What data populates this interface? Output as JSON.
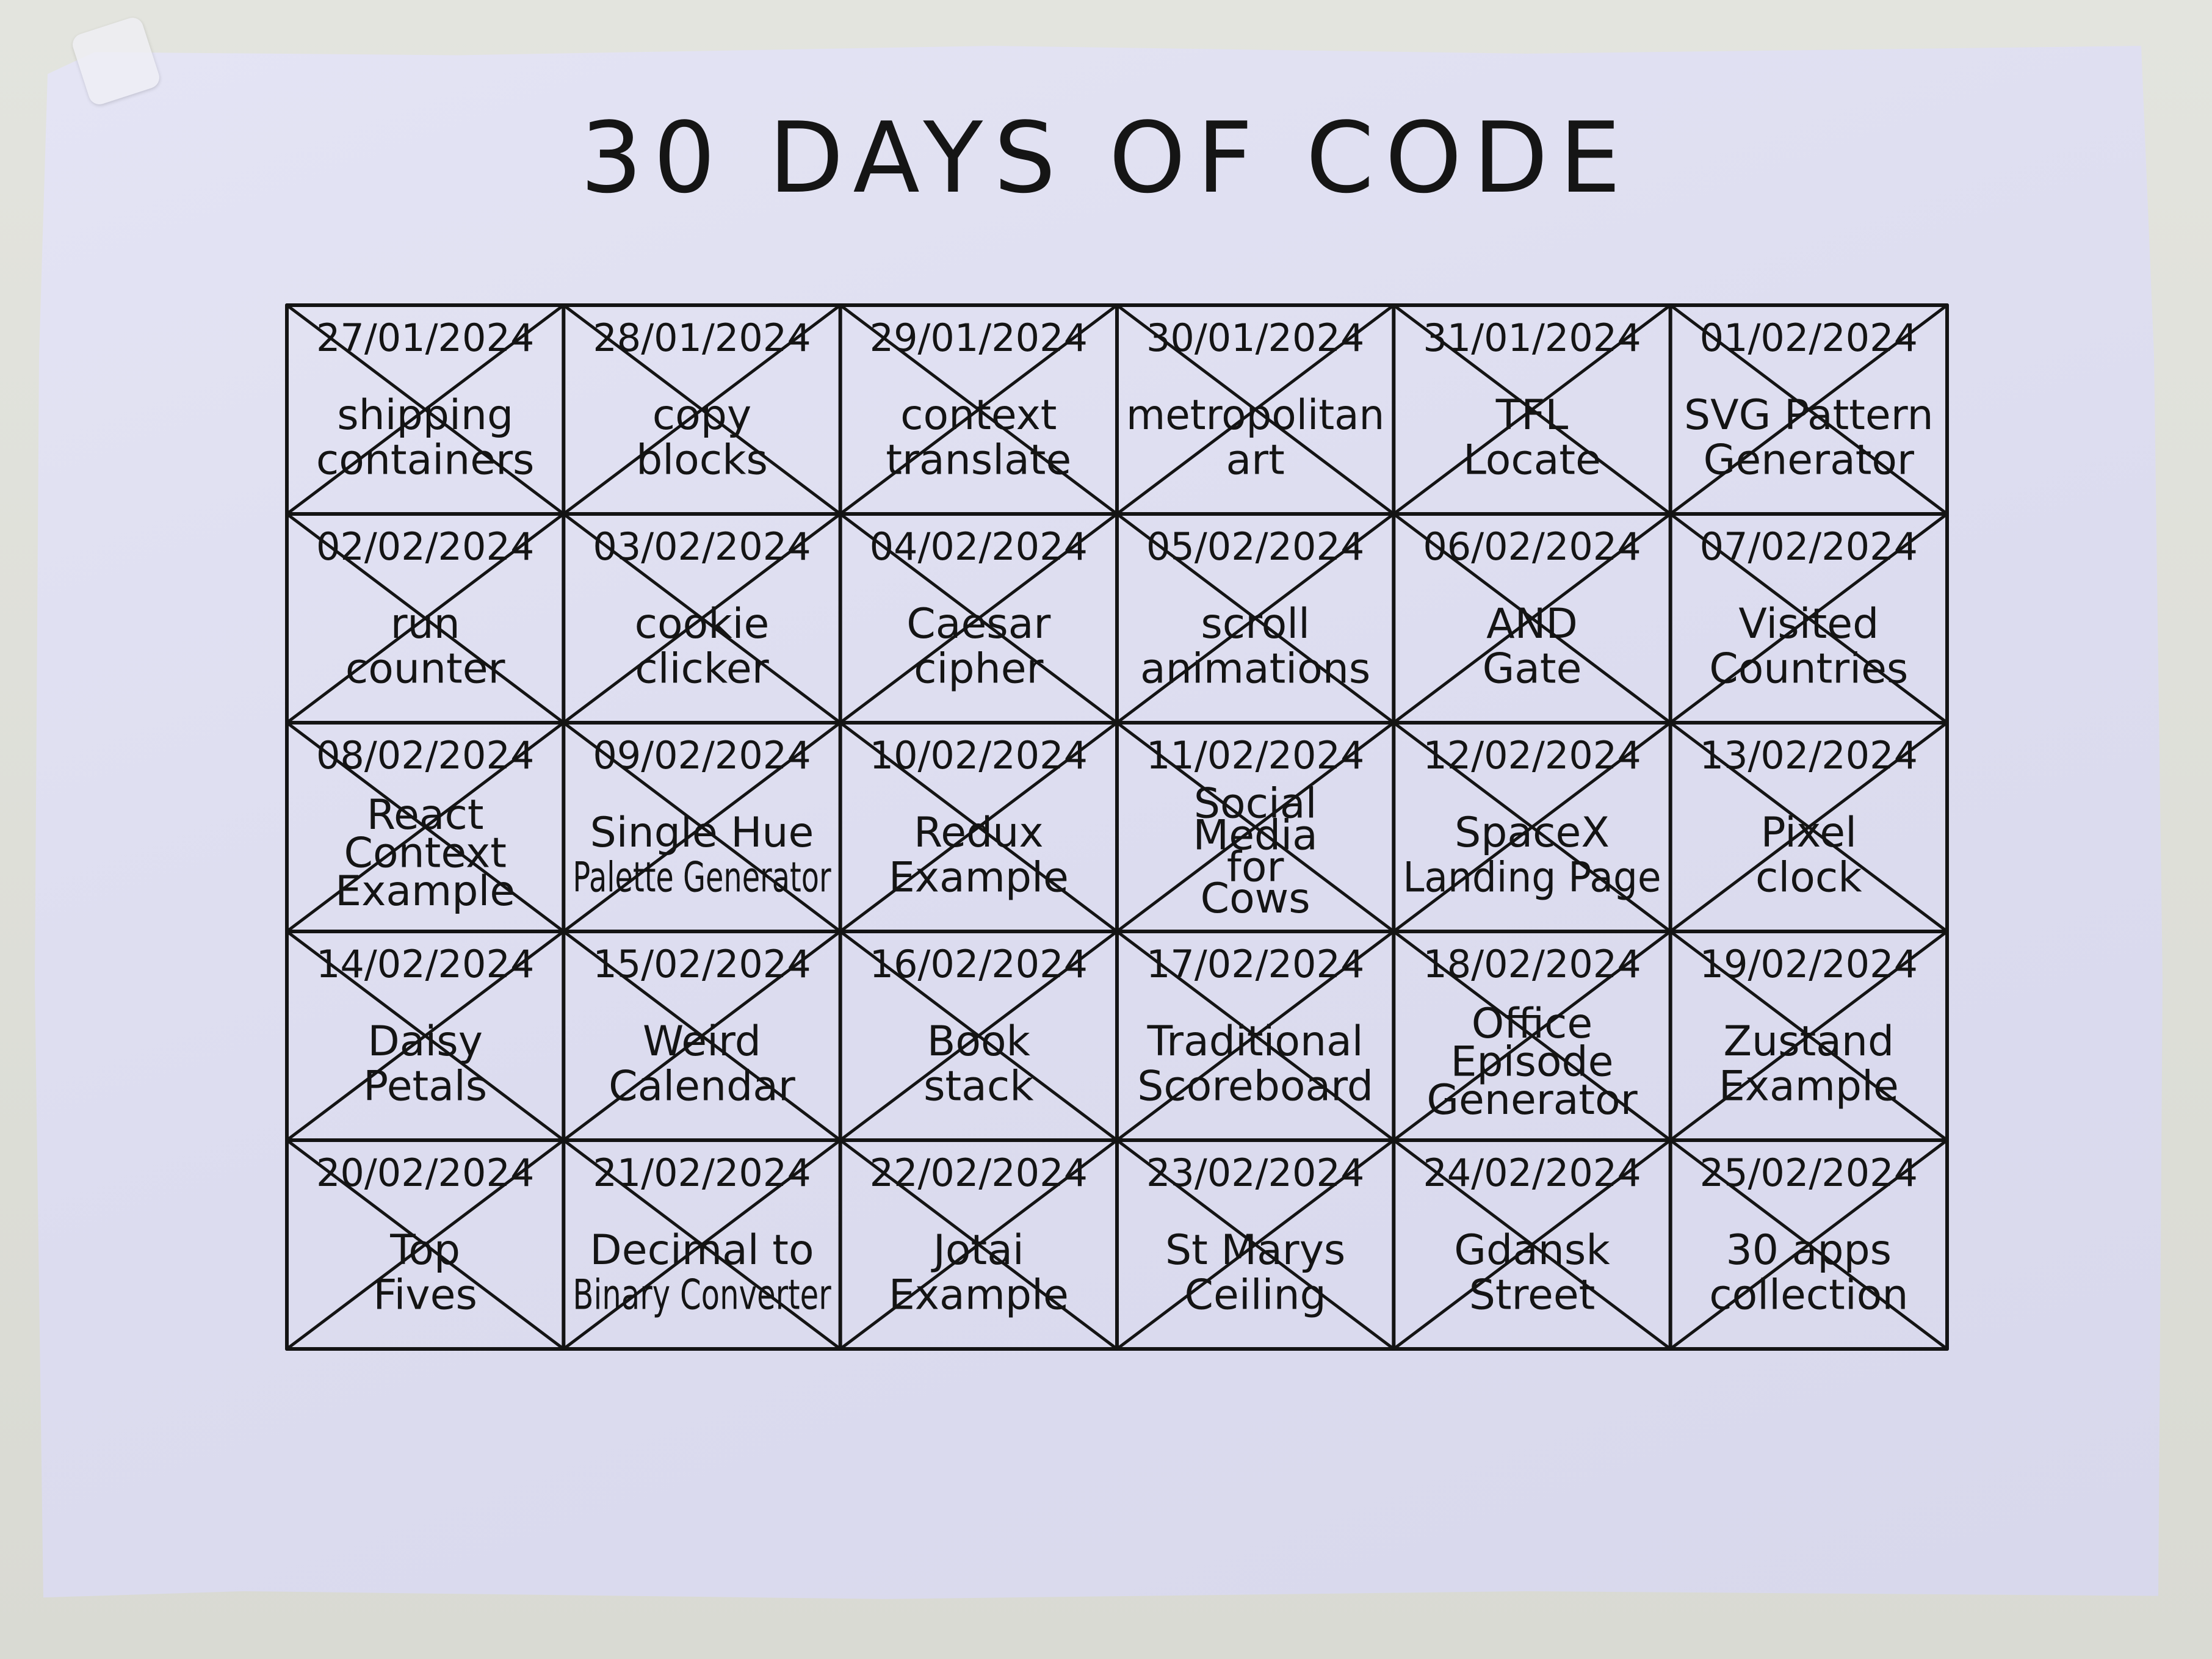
{
  "title": "30 DAYS OF CODE",
  "ink_color": "#141414",
  "paper_color": "#e0e0f2",
  "days": [
    {
      "date": "27/01/2024",
      "title": "shipping containers",
      "lines": [
        "shipping",
        "containers"
      ],
      "crossed_out": true
    },
    {
      "date": "28/01/2024",
      "title": "copy blocks",
      "lines": [
        "copy",
        "blocks"
      ],
      "crossed_out": true
    },
    {
      "date": "29/01/2024",
      "title": "context translate",
      "lines": [
        "context",
        "translate"
      ],
      "crossed_out": true
    },
    {
      "date": "30/01/2024",
      "title": "metropolitan art",
      "lines": [
        "metropolitan",
        "art"
      ],
      "crossed_out": true
    },
    {
      "date": "31/01/2024",
      "title": "TFL Locate",
      "lines": [
        "TFL",
        "Locate"
      ],
      "crossed_out": true
    },
    {
      "date": "01/02/2024",
      "title": "SVG Pattern Generator",
      "lines": [
        "SVG Pattern",
        "Generator"
      ],
      "crossed_out": true
    },
    {
      "date": "02/02/2024",
      "title": "run counter",
      "lines": [
        "run",
        "counter"
      ],
      "crossed_out": true
    },
    {
      "date": "03/02/2024",
      "title": "cookie clicker",
      "lines": [
        "cookie",
        "clicker"
      ],
      "crossed_out": true
    },
    {
      "date": "04/02/2024",
      "title": "Caesar cipher",
      "lines": [
        "Caesar",
        "cipher"
      ],
      "crossed_out": true
    },
    {
      "date": "05/02/2024",
      "title": "scroll animations",
      "lines": [
        "scroll",
        "animations"
      ],
      "crossed_out": true
    },
    {
      "date": "06/02/2024",
      "title": "AND Gate",
      "lines": [
        "AND",
        "Gate"
      ],
      "crossed_out": true
    },
    {
      "date": "07/02/2024",
      "title": "Visited Countries",
      "lines": [
        "Visited",
        "Countries"
      ],
      "crossed_out": true
    },
    {
      "date": "08/02/2024",
      "title": "React Context Example",
      "lines": [
        "React",
        "Context",
        "Example"
      ],
      "crossed_out": true
    },
    {
      "date": "09/02/2024",
      "title": "Single Hue Palette Generator",
      "lines": [
        "Single Hue",
        "Palette Generator"
      ],
      "crossed_out": true
    },
    {
      "date": "10/02/2024",
      "title": "Redux Example",
      "lines": [
        "Redux",
        "Example"
      ],
      "crossed_out": true
    },
    {
      "date": "11/02/2024",
      "title": "Social Media for Cows",
      "lines": [
        "Social",
        "Media",
        "for",
        "Cows"
      ],
      "crossed_out": true
    },
    {
      "date": "12/02/2024",
      "title": "SpaceX Landing Page",
      "lines": [
        "SpaceX",
        "Landing Page"
      ],
      "crossed_out": true
    },
    {
      "date": "13/02/2024",
      "title": "Pixel clock",
      "lines": [
        "Pixel",
        "clock"
      ],
      "crossed_out": true
    },
    {
      "date": "14/02/2024",
      "title": "Daisy Petals",
      "lines": [
        "Daisy",
        "Petals"
      ],
      "crossed_out": true
    },
    {
      "date": "15/02/2024",
      "title": "Weird Calendar",
      "lines": [
        "Weird",
        "Calendar"
      ],
      "crossed_out": true
    },
    {
      "date": "16/02/2024",
      "title": "Book stack",
      "lines": [
        "Book",
        "stack"
      ],
      "crossed_out": true
    },
    {
      "date": "17/02/2024",
      "title": "Traditional Scoreboard",
      "lines": [
        "Traditional",
        "Scoreboard"
      ],
      "crossed_out": true
    },
    {
      "date": "18/02/2024",
      "title": "Office Episode Generator",
      "lines": [
        "Office",
        "Episode",
        "Generator"
      ],
      "crossed_out": true
    },
    {
      "date": "19/02/2024",
      "title": "Zustand Example",
      "lines": [
        "Zustand",
        "Example"
      ],
      "crossed_out": true
    },
    {
      "date": "20/02/2024",
      "title": "Top Fives",
      "lines": [
        "Top",
        "Fives"
      ],
      "crossed_out": true
    },
    {
      "date": "21/02/2024",
      "title": "Decimal to Binary Converter",
      "lines": [
        "Decimal to",
        "Binary Converter"
      ],
      "crossed_out": true
    },
    {
      "date": "22/02/2024",
      "title": "Jotai Example",
      "lines": [
        "Jotai",
        "Example"
      ],
      "crossed_out": true
    },
    {
      "date": "23/02/2024",
      "title": "St Marys Ceiling",
      "lines": [
        "St Marys",
        "Ceiling"
      ],
      "crossed_out": true
    },
    {
      "date": "24/02/2024",
      "title": "Gdansk Street",
      "lines": [
        "Gdansk",
        "Street"
      ],
      "crossed_out": true
    },
    {
      "date": "25/02/2024",
      "title": "30 apps collection",
      "lines": [
        "30 apps",
        "collection"
      ],
      "crossed_out": true
    }
  ]
}
